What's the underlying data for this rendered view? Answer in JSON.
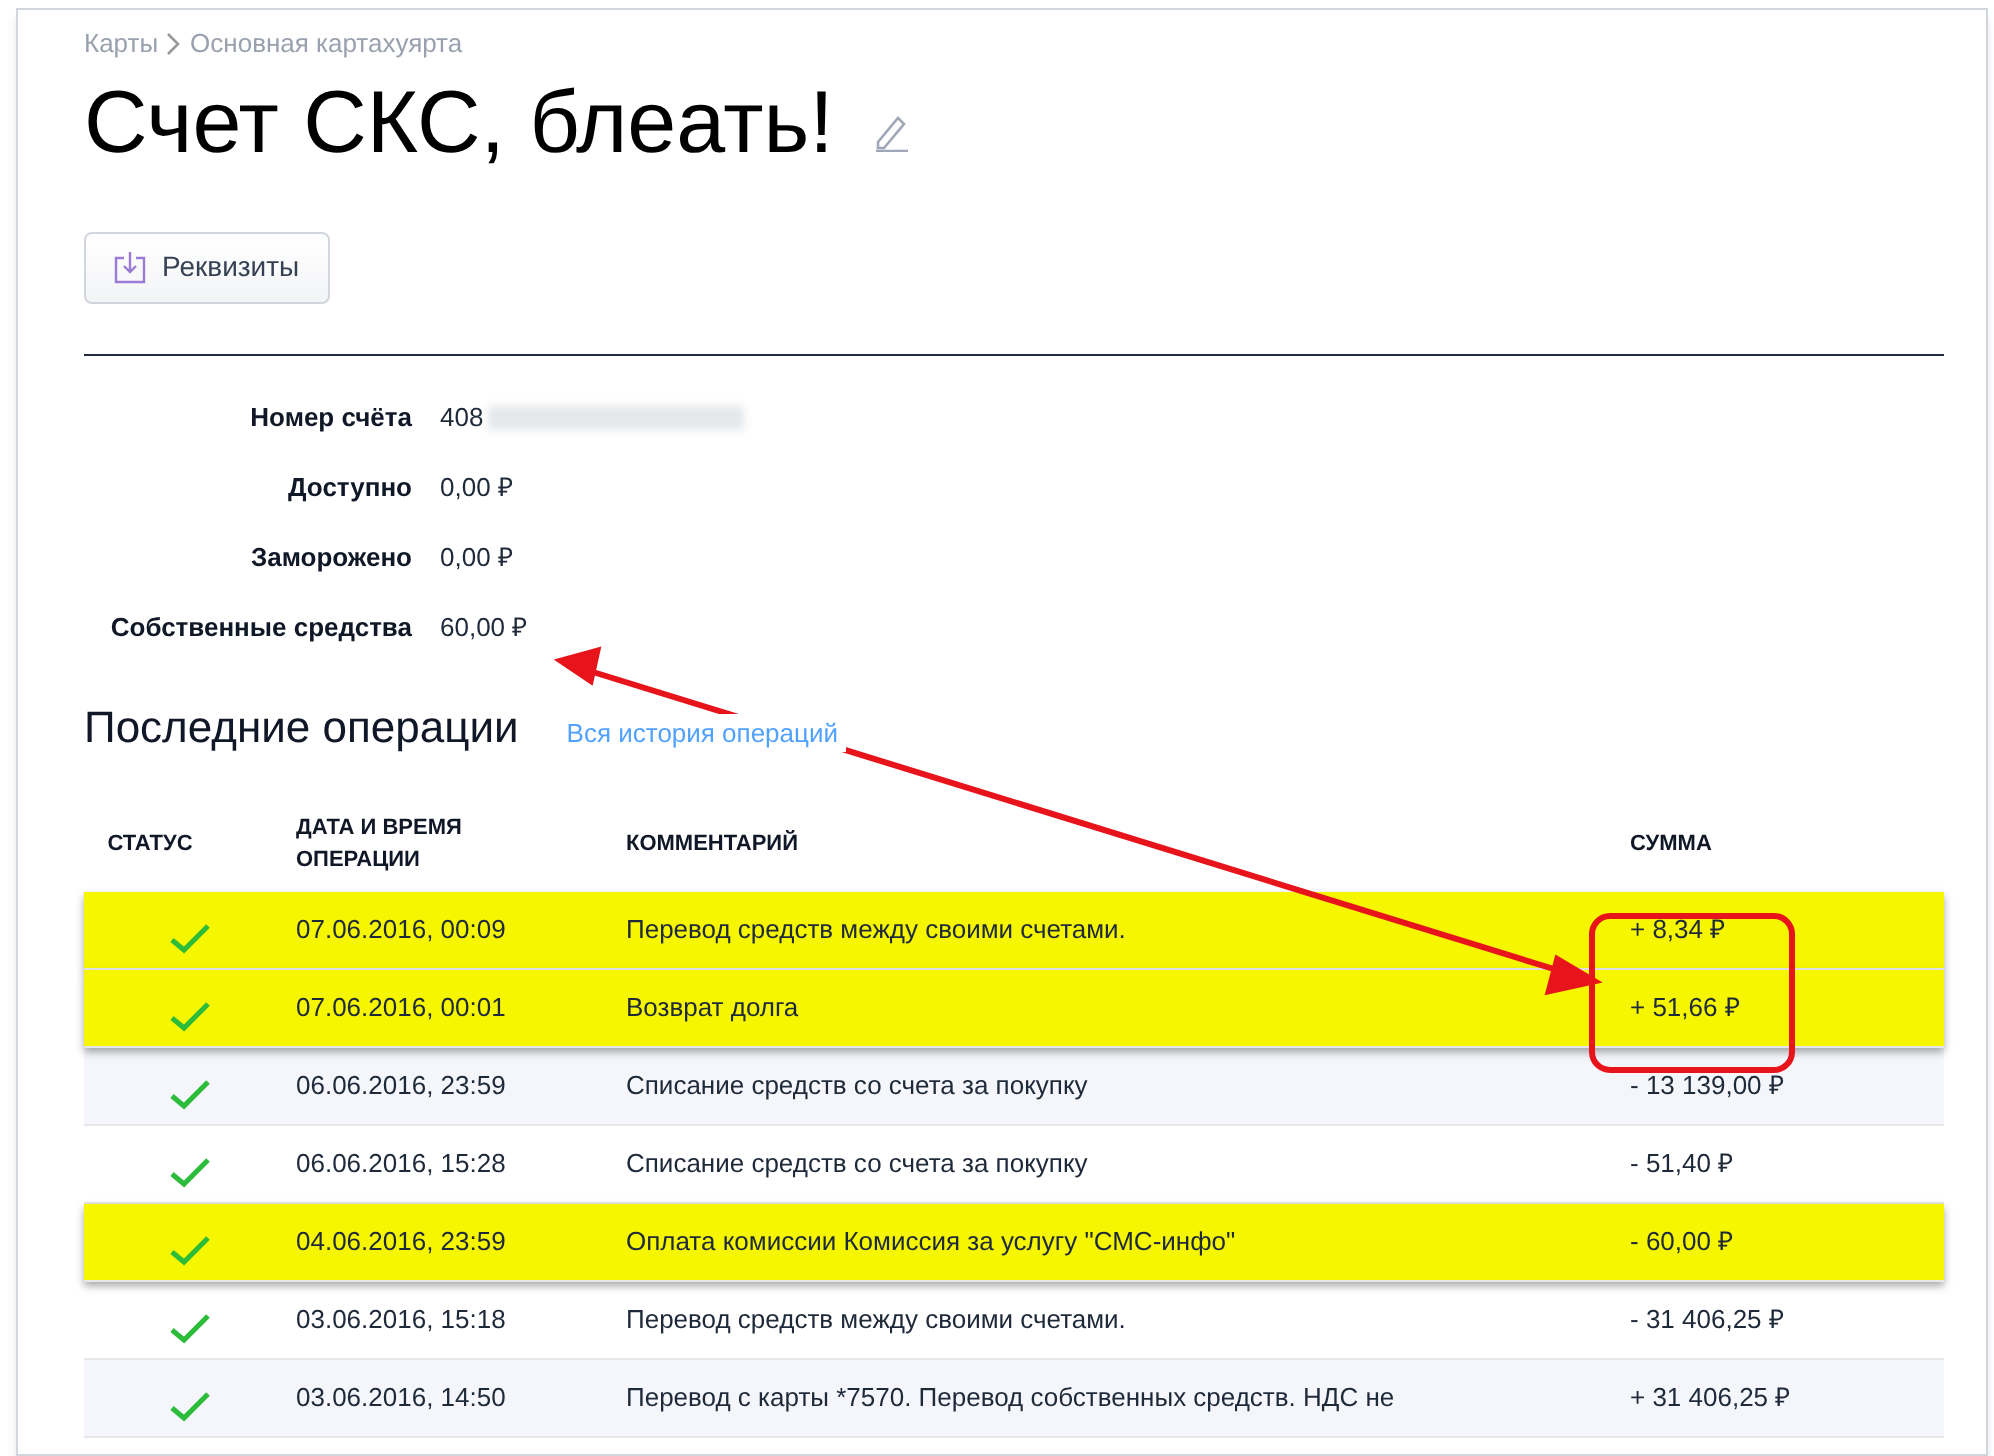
{
  "breadcrumbs": [
    "Карты",
    "Основная картахуярта"
  ],
  "title": "Счет СКС, блеать!",
  "details_button": "Реквизиты",
  "account": [
    {
      "label": "Номер счёта",
      "value": "408",
      "redacted": true
    },
    {
      "label": "Доступно",
      "value": "0,00 ₽",
      "redacted": false
    },
    {
      "label": "Заморожено",
      "value": "0,00 ₽",
      "redacted": false
    },
    {
      "label": "Собственные средства",
      "value": "60,00 ₽",
      "redacted": false
    }
  ],
  "operations_title": "Последние операции",
  "history_link": "Вся история операций",
  "table": {
    "columns": [
      "СТАТУС",
      "ДАТА И ВРЕМЯ ОПЕРАЦИИ",
      "КОММЕНТАРИЙ",
      "СУММА"
    ],
    "rows": [
      {
        "completed": true,
        "date": "07.06.2016, 00:09",
        "comment": "Перевод средств между своими счетами.",
        "amount": "+ 8,34 ₽",
        "highlighted": true
      },
      {
        "completed": true,
        "date": "07.06.2016, 00:01",
        "comment": "Возврат долга",
        "amount": "+ 51,66 ₽",
        "highlighted": true
      },
      {
        "completed": true,
        "date": "06.06.2016, 23:59",
        "comment": "Списание средств со счета за покупку",
        "amount": "- 13 139,00 ₽",
        "highlighted": false
      },
      {
        "completed": true,
        "date": "06.06.2016, 15:28",
        "comment": "Списание средств со счета за покупку",
        "amount": "- 51,40 ₽",
        "highlighted": false
      },
      {
        "completed": true,
        "date": "04.06.2016, 23:59",
        "comment": "Оплата комиссии Комиссия за услугу \"СМС-инфо\"",
        "amount": "- 60,00 ₽",
        "highlighted": true
      },
      {
        "completed": true,
        "date": "03.06.2016, 15:18",
        "comment": "Перевод средств между своими счетами.",
        "amount": "- 31 406,25 ₽",
        "highlighted": false
      },
      {
        "completed": true,
        "date": "03.06.2016, 14:50",
        "comment": "Перевод с карты *7570. Перевод собственных средств. НДС не",
        "amount": "+ 31 406,25 ₽",
        "highlighted": false
      }
    ]
  }
}
